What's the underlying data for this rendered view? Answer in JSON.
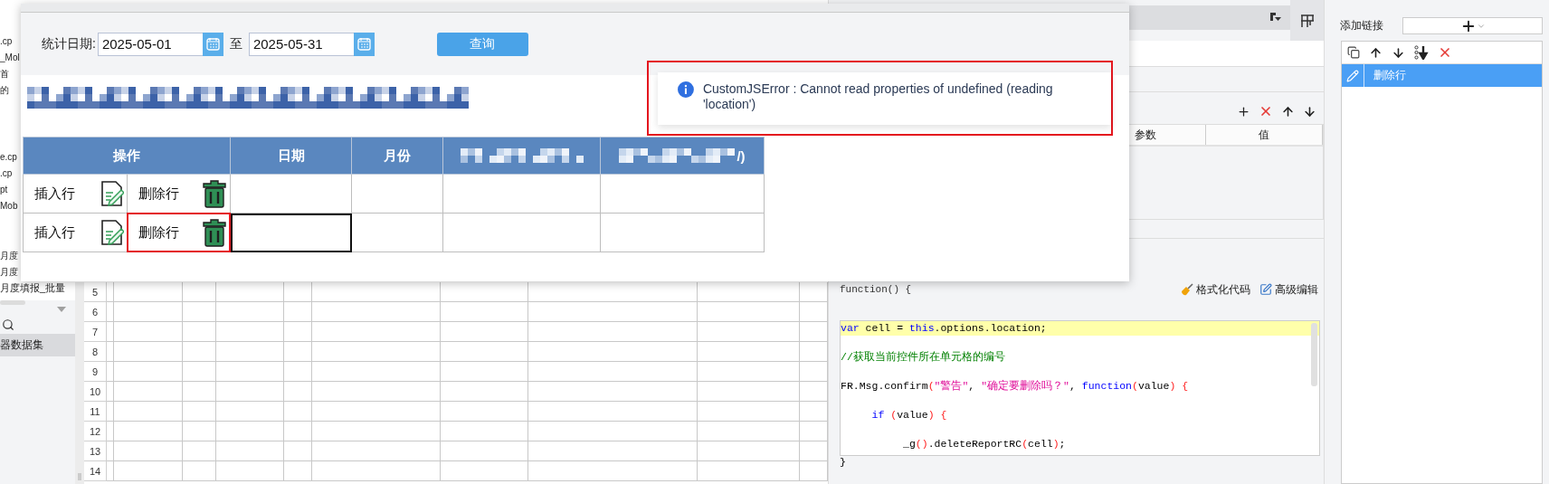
{
  "left_panel": {
    "groups": [
      {
        "items": [
          ".cp",
          "_Mol",
          "首",
          "的"
        ]
      },
      {
        "items": [
          "e.cp",
          ".cp",
          "pt",
          "Mob"
        ]
      },
      {
        "items": [
          "月度",
          "月度"
        ]
      }
    ],
    "tail_item": "月度填报_批量",
    "dataset_item": {
      "label": "器数据集",
      "selected": true
    }
  },
  "sheet": {
    "row_numbers": [
      "5",
      "6",
      "7",
      "8",
      "9",
      "10",
      "11",
      "12",
      "13",
      "14"
    ]
  },
  "param_panel": {
    "columns": [
      "参数",
      "值"
    ]
  },
  "script_panel": {
    "header": "function() {",
    "buttons": [
      "格式化代码",
      "高级编辑"
    ],
    "lines": [
      {
        "highlighted": true,
        "tokens": [
          {
            "kind": "keyword",
            "text": "var"
          },
          {
            "kind": "plain",
            "text": " cell = "
          },
          {
            "kind": "keyword",
            "text": "this"
          },
          {
            "kind": "plain",
            "text": ".options.location;"
          }
        ]
      },
      {
        "highlighted": false,
        "tokens": [
          {
            "kind": "comment",
            "text": "//获取当前控件所在单元格的编号"
          }
        ]
      },
      {
        "highlighted": false,
        "tokens": [
          {
            "kind": "plain",
            "text": "FR.Msg.confirm"
          },
          {
            "kind": "paren",
            "text": "("
          },
          {
            "kind": "string",
            "text": "\"警告\""
          },
          {
            "kind": "plain",
            "text": ", "
          },
          {
            "kind": "string",
            "text": "\"确定要删除吗？\""
          },
          {
            "kind": "plain",
            "text": ", "
          },
          {
            "kind": "keyword",
            "text": "function"
          },
          {
            "kind": "paren",
            "text": "("
          },
          {
            "kind": "plain",
            "text": "value"
          },
          {
            "kind": "paren",
            "text": ")"
          },
          {
            "kind": "paren",
            "text": " {"
          }
        ]
      },
      {
        "highlighted": false,
        "tokens": [
          {
            "kind": "keyword",
            "text": "     if"
          },
          {
            "kind": "paren",
            "text": " ("
          },
          {
            "kind": "plain",
            "text": "value"
          },
          {
            "kind": "paren",
            "text": ")"
          },
          {
            "kind": "paren",
            "text": " {"
          }
        ]
      },
      {
        "highlighted": false,
        "tokens": [
          {
            "kind": "plain",
            "text": "          _g"
          },
          {
            "kind": "paren",
            "text": "()"
          },
          {
            "kind": "plain",
            "text": ".deleteReportRC"
          },
          {
            "kind": "paren",
            "text": "("
          },
          {
            "kind": "plain",
            "text": "cell"
          },
          {
            "kind": "paren",
            "text": ")"
          },
          {
            "kind": "plain",
            "text": ";"
          }
        ]
      }
    ],
    "footer": "}"
  },
  "link_panel": {
    "label": "添加链接",
    "items": [
      {
        "label": "删除行",
        "selected": true
      }
    ]
  },
  "preview": {
    "filter": {
      "label": "统计日期:",
      "start": "2025-05-01",
      "separator": "至",
      "end": "2025-05-31",
      "button": "查询"
    },
    "title": {
      "kind": "pixelated"
    },
    "table": {
      "columns": [
        {
          "kind": "text",
          "label": "操作"
        },
        {
          "kind": "text",
          "label": "日期"
        },
        {
          "kind": "text",
          "label": "月份"
        },
        {
          "kind": "pixelated"
        },
        {
          "kind": "pixelated",
          "label": "/)"
        }
      ],
      "rows": [
        {
          "insert": "插入行",
          "delete": "删除行",
          "delete_flagged": false,
          "date_selected": false
        },
        {
          "insert": "插入行",
          "delete": "删除行",
          "delete_flagged": true,
          "date_selected": true
        }
      ]
    },
    "error_toast": {
      "message": "CustomJSError : Cannot read properties of undefined (reading 'location')",
      "flagged": true
    }
  }
}
